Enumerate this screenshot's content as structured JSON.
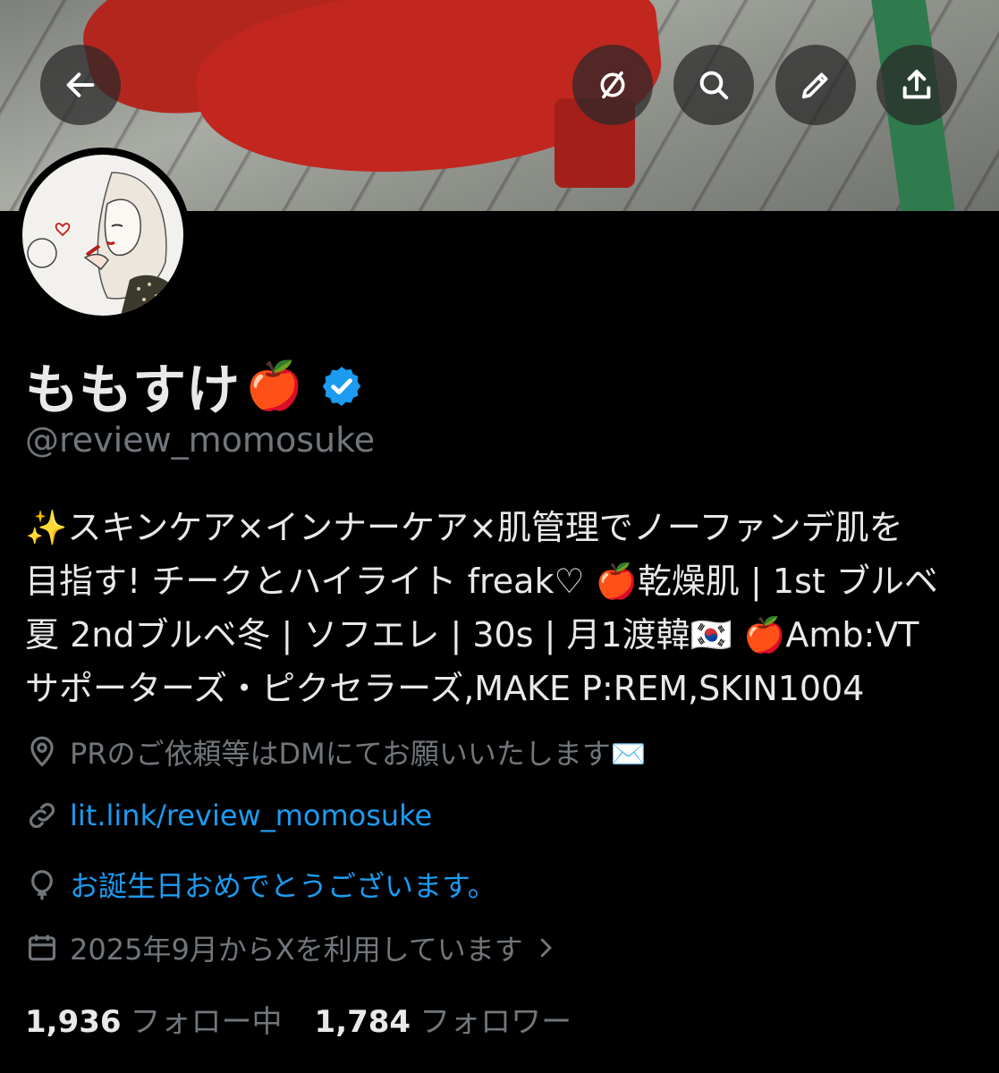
{
  "banner": {
    "image": "red-shoes-photo"
  },
  "toolbar": {
    "back_icon": "arrow-left-icon",
    "mute_icon": "slashed-circle-icon",
    "search_icon": "search-icon",
    "edit_icon": "pencil-icon",
    "share_icon": "share-icon"
  },
  "profile": {
    "name": "ももすけ",
    "name_emoji": "🍎",
    "verified_color": "#1d9bf0",
    "handle": "@review_momosuke",
    "bio_lines": [
      "✨スキンケア×インナーケア×肌管理でノーファンデ肌を",
      "目指す! チークとハイライト freak♡ 🍎乾燥肌 | 1st ブルベ",
      "夏 2ndブルベ冬 | ソフエレ | 30s | 月1渡韓🇰🇷 🍎Amb:VT",
      "サポーターズ・ピクセラーズ,MAKE P:REM,SKIN1004"
    ],
    "location": "PRのご依頼等はDMにてお願いいたします✉️",
    "link": "lit.link/review_momosuke",
    "birthday": "お誕生日おめでとうございます。",
    "joined": "2025年9月からXを利用しています",
    "following_count": "1,936",
    "following_label": "フォロー中",
    "followers_count": "1,784",
    "followers_label": "フォロワー"
  },
  "colors": {
    "background": "#000000",
    "text": "#e7e9ea",
    "secondary": "#71767b",
    "link": "#1d9bf0"
  }
}
